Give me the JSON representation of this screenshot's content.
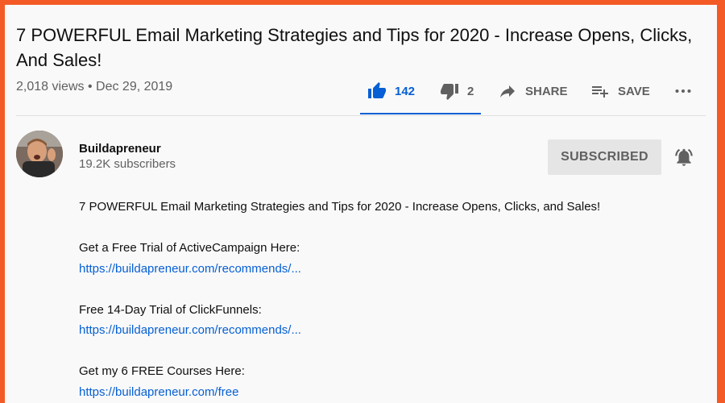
{
  "video": {
    "title": "7 POWERFUL Email Marketing Strategies and Tips for 2020 - Increase Opens, Clicks, And Sales!",
    "views": "2,018 views",
    "separator": "•",
    "date": "Dec 29, 2019"
  },
  "actions": {
    "likes": "142",
    "dislikes": "2",
    "share_label": "SHARE",
    "save_label": "SAVE"
  },
  "channel": {
    "name": "Buildapreneur",
    "subscribers": "19.2K subscribers",
    "subscribe_label": "SUBSCRIBED"
  },
  "description": {
    "intro": "7 POWERFUL Email Marketing Strategies and Tips for 2020 - Increase Opens, Clicks, and Sales!",
    "links": [
      {
        "label": "Get a Free Trial of ActiveCampaign Here:",
        "url": "https://buildapreneur.com/recommends/..."
      },
      {
        "label": "Free 14-Day Trial of ClickFunnels:",
        "url": "https://buildapreneur.com/recommends/..."
      },
      {
        "label": "Get my 6 FREE Courses Here:",
        "url": "https://buildapreneur.com/free"
      }
    ]
  },
  "colors": {
    "accent": "#065fd4",
    "border": "#f35a26",
    "background": "#f9f9f9"
  },
  "icons": [
    "thumbs-up-icon",
    "thumbs-down-icon",
    "share-arrow-icon",
    "playlist-add-icon",
    "more-dots-icon",
    "bell-icon"
  ]
}
